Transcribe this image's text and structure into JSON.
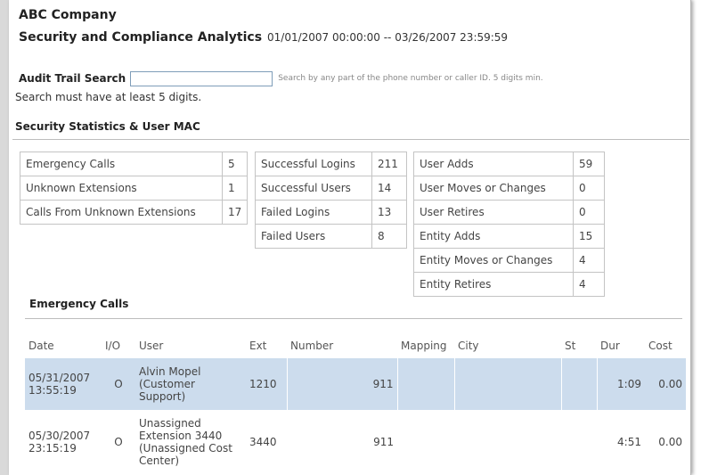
{
  "header": {
    "company": "ABC Company",
    "report_title": "Security and Compliance Analytics",
    "date_range": "01/01/2007 00:00:00 -- 03/26/2007 23:59:59"
  },
  "search": {
    "label": "Audit Trail Search",
    "value": "",
    "help": "Search by any part of the phone number or caller ID. 5 digits min.",
    "message": "Search must have at least 5 digits."
  },
  "stats_section": {
    "title": "Security Statistics & User MAC",
    "group1": [
      {
        "label": "Emergency Calls",
        "value": "5"
      },
      {
        "label": "Unknown Extensions",
        "value": "1"
      },
      {
        "label": "Calls From Unknown Extensions",
        "value": "17"
      }
    ],
    "group2": [
      {
        "label": "Successful Logins",
        "value": "211"
      },
      {
        "label": "Successful Users",
        "value": "14"
      },
      {
        "label": "Failed Logins",
        "value": "13"
      },
      {
        "label": "Failed Users",
        "value": "8"
      }
    ],
    "group3": [
      {
        "label": "User Adds",
        "value": "59"
      },
      {
        "label": "User Moves or Changes",
        "value": "0"
      },
      {
        "label": "User Retires",
        "value": "0"
      },
      {
        "label": "Entity Adds",
        "value": "15"
      },
      {
        "label": "Entity Moves or Changes",
        "value": "4"
      },
      {
        "label": "Entity Retires",
        "value": "4"
      }
    ]
  },
  "emergency_calls": {
    "title": "Emergency Calls",
    "columns": [
      "Date",
      "I/O",
      "User",
      "Ext",
      "Number",
      "Mapping",
      "City",
      "St",
      "Dur",
      "Cost"
    ],
    "rows": [
      {
        "date": "05/31/2007 13:55:19",
        "io": "O",
        "user": "Alvin Mopel (Customer Support)",
        "ext": "1210",
        "number": "911",
        "mapping": "",
        "city": "",
        "st": "",
        "dur": "1:09",
        "cost": "0.00"
      },
      {
        "date": "05/30/2007 23:15:19",
        "io": "O",
        "user": "Unassigned Extension 3440 (Unassigned Cost Center)",
        "ext": "3440",
        "number": "911",
        "mapping": "",
        "city": "",
        "st": "",
        "dur": "4:51",
        "cost": "0.00"
      }
    ]
  }
}
